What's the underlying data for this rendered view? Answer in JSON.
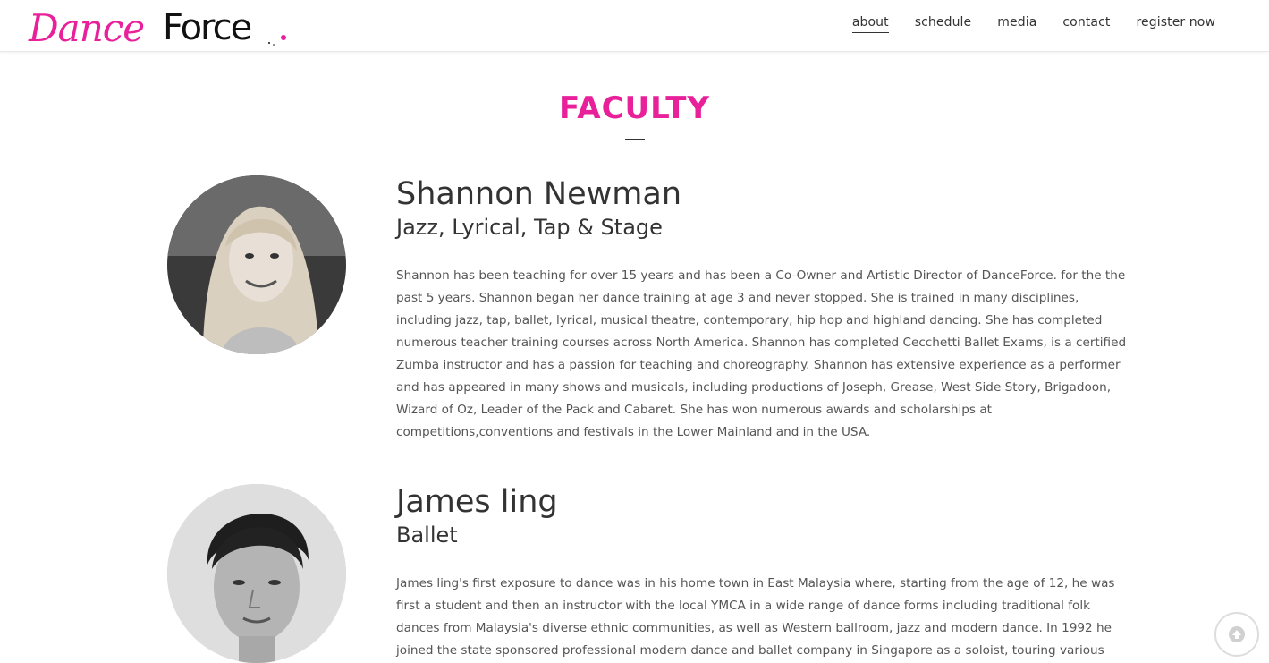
{
  "brand": {
    "logo_text_script": "Dance",
    "logo_text_bold": "Force",
    "accent_color": "#e8219a"
  },
  "nav": {
    "items": [
      {
        "label": "about",
        "active": true
      },
      {
        "label": "schedule",
        "active": false
      },
      {
        "label": "media",
        "active": false
      },
      {
        "label": "contact",
        "active": false
      },
      {
        "label": "register now",
        "active": false
      }
    ]
  },
  "section": {
    "title": "FACULTY"
  },
  "faculty": [
    {
      "name": "Shannon Newman",
      "role": "Jazz, Lyrical, Tap & Stage",
      "bio": "Shannon has been teaching for over 15 years and has been a Co-Owner and Artistic Director of DanceForce. for the the past 5 years. Shannon began her dance training at age 3 and never stopped. She is trained in many disciplines, including jazz, tap, ballet, lyrical, musical theatre, contemporary, hip hop and highland dancing. She has completed numerous teacher training courses across North America. Shannon has completed Cecchetti Ballet Exams, is a certified Zumba instructor and has a passion for teaching and choreography. Shannon has extensive experience as a performer and has appeared in many shows and musicals, including productions of Joseph, Grease, West Side Story, Brigadoon, Wizard of Oz, Leader of the Pack and Cabaret. She has won numerous awards and scholarships at competitions,conventions and festivals in the Lower Mainland and in the USA."
    },
    {
      "name": "James ling",
      "role": "Ballet",
      "bio": "James ling's first exposure to dance was in his home town in East Malaysia where, starting from the age of 12, he was first a student and then an instructor with the local YMCA in a wide range of dance forms including traditional folk dances from Malaysia's diverse ethnic communities, as well as Western ballroom, jazz and modern dance. In 1992 he joined the state sponsored professional modern dance and ballet company in Singapore as a soloist, touring various"
    }
  ],
  "icons": {
    "scroll_top": "arrow-up-circle-icon"
  }
}
